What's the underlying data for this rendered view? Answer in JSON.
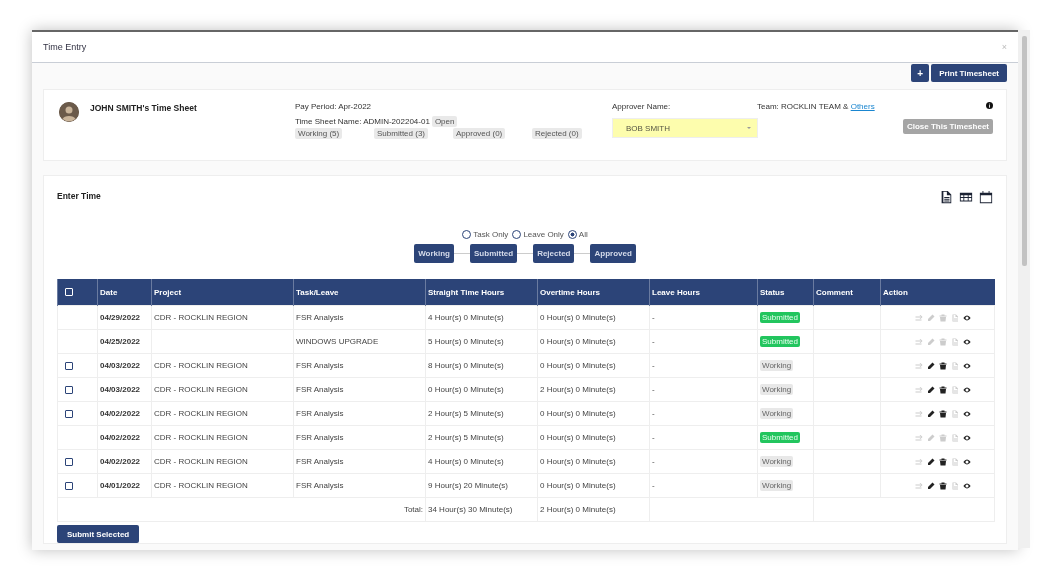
{
  "window": {
    "title": "Time Entry",
    "close": "×"
  },
  "toolbar": {
    "add": "+",
    "print": "Print Timesheet"
  },
  "timesheet": {
    "owner": "JOHN SMITH's Time Sheet",
    "pay_period": "Pay Period: Apr-2022",
    "sheet_name": "Time Sheet Name: ADMIN-202204-01",
    "sheet_state": "Open",
    "counts": [
      "Working (5)",
      "Submitted (3)",
      "Approved (0)",
      "Rejected (0)"
    ],
    "approver_label": "Approver Name:",
    "approver": "BOB SMITH",
    "team": "Team: ROCKLIN TEAM & ",
    "team_link": "Others",
    "close_button": "Close This Timesheet"
  },
  "enter_time": {
    "title": "Enter Time",
    "filters": [
      {
        "label": "Task Only",
        "selected": false
      },
      {
        "label": "Leave Only",
        "selected": false
      },
      {
        "label": "All",
        "selected": true
      }
    ],
    "steps": [
      "Working",
      "Submitted",
      "Rejected",
      "Approved"
    ]
  },
  "table": {
    "select_all": {
      "checked": false
    },
    "columns": [
      "Date",
      "Project",
      "Task/Leave",
      "Straight Time Hours",
      "Overtime Hours",
      "Leave Hours",
      "Status",
      "Comment",
      "Action"
    ],
    "rows": [
      {
        "kind": "submitted",
        "date": "04/29/2022",
        "project": "CDR - ROCKLIN REGION",
        "task": "FSR Analysis",
        "straight": "4 Hour(s) 0 Minute(s)",
        "overtime": "0 Hour(s) 0 Minute(s)",
        "leave": "-",
        "status": "Submitted"
      },
      {
        "kind": "submitted",
        "date": "04/25/2022",
        "task": "WINDOWS UPGRADE",
        "straight": "5 Hour(s) 0 Minute(s)",
        "overtime": "0 Hour(s) 0 Minute(s)",
        "leave": "-",
        "status": "Submitted"
      },
      {
        "kind": "working",
        "checkbox": {
          "checked": false
        },
        "date": "04/03/2022",
        "project": "CDR - ROCKLIN REGION",
        "task": "FSR Analysis",
        "straight": "8 Hour(s) 0 Minute(s)",
        "overtime": "0 Hour(s) 0 Minute(s)",
        "leave": "-",
        "status": "Working"
      },
      {
        "kind": "working",
        "checkbox": {
          "checked": false
        },
        "date": "04/03/2022",
        "project": "CDR - ROCKLIN REGION",
        "task": "FSR Analysis",
        "straight": "0 Hour(s) 0 Minute(s)",
        "overtime": "2 Hour(s) 0 Minute(s)",
        "leave": "-",
        "status": "Working"
      },
      {
        "kind": "working",
        "checkbox": {
          "checked": false
        },
        "date": "04/02/2022",
        "project": "CDR - ROCKLIN REGION",
        "task": "FSR Analysis",
        "straight": "2 Hour(s) 5 Minute(s)",
        "overtime": "0 Hour(s) 0 Minute(s)",
        "leave": "-",
        "status": "Working"
      },
      {
        "kind": "submitted",
        "date": "04/02/2022",
        "project": "CDR - ROCKLIN REGION",
        "task": "FSR Analysis",
        "straight": "2 Hour(s) 5 Minute(s)",
        "overtime": "0 Hour(s) 0 Minute(s)",
        "leave": "-",
        "status": "Submitted"
      },
      {
        "kind": "working",
        "checkbox": {
          "checked": false
        },
        "date": "04/02/2022",
        "project": "CDR - ROCKLIN REGION",
        "task": "FSR Analysis",
        "straight": "4 Hour(s) 0 Minute(s)",
        "overtime": "0 Hour(s) 0 Minute(s)",
        "leave": "-",
        "status": "Working"
      },
      {
        "kind": "working",
        "checkbox": {
          "checked": false
        },
        "date": "04/01/2022",
        "project": "CDR - ROCKLIN REGION",
        "task": "FSR Analysis",
        "straight": "9 Hour(s) 20 Minute(s)",
        "overtime": "0 Hour(s) 0 Minute(s)",
        "leave": "-",
        "status": "Working"
      }
    ],
    "total": {
      "label": "Total:",
      "straight": "34 Hour(s) 30 Minute(s)",
      "overtime": "2 Hour(s) 0 Minute(s)"
    }
  },
  "submit_button": "Submit Selected"
}
